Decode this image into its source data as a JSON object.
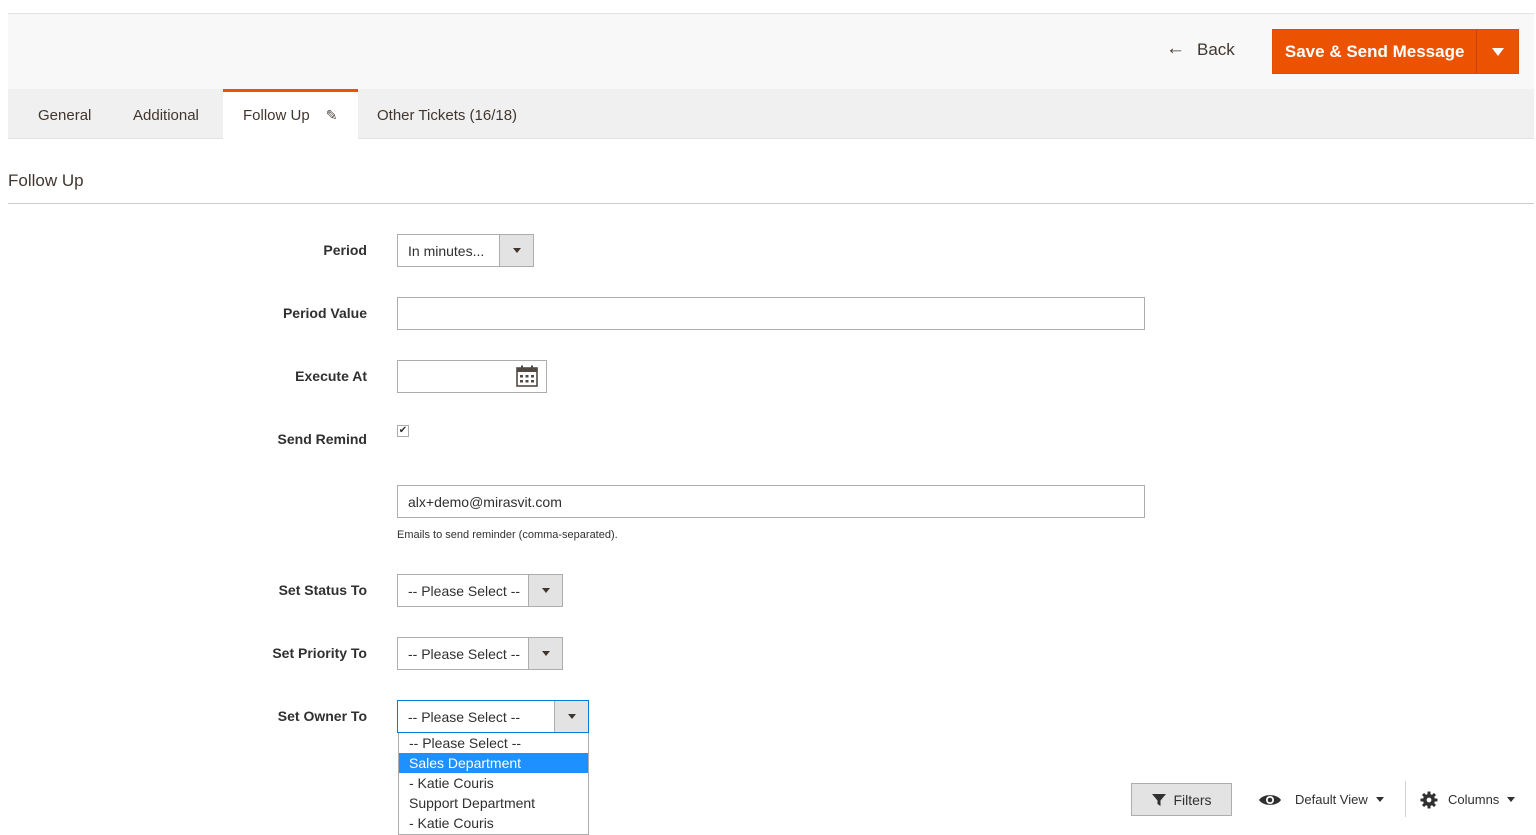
{
  "actions": {
    "back_label": "Back",
    "save_label": "Save & Send Message"
  },
  "tabs": [
    {
      "label": "General"
    },
    {
      "label": "Additional"
    },
    {
      "label": "Follow Up"
    },
    {
      "label": "Other Tickets (16/18)"
    }
  ],
  "section": {
    "title": "Follow Up"
  },
  "form": {
    "period": {
      "label": "Period",
      "value": "In minutes..."
    },
    "period_value": {
      "label": "Period Value",
      "value": ""
    },
    "execute_at": {
      "label": "Execute At",
      "value": ""
    },
    "send_remind": {
      "label": "Send Remind",
      "checked": true
    },
    "remind_emails": {
      "value": "alx+demo@mirasvit.com",
      "note": "Emails to send reminder (comma-separated)."
    },
    "set_status": {
      "label": "Set Status To",
      "value": "-- Please Select --"
    },
    "set_priority": {
      "label": "Set Priority To",
      "value": "-- Please Select --"
    },
    "set_owner": {
      "label": "Set Owner To",
      "value": "-- Please Select --",
      "options": [
        "-- Please Select --",
        "Sales Department",
        "- Katie Couris",
        "Support Department",
        "- Katie Couris"
      ],
      "highlighted_index": 1
    }
  },
  "grid_toolbar": {
    "filters_label": "Filters",
    "view_label": "Default View",
    "columns_label": "Columns"
  },
  "colors": {
    "accent": "#eb5202",
    "highlight": "#1e90ff"
  }
}
